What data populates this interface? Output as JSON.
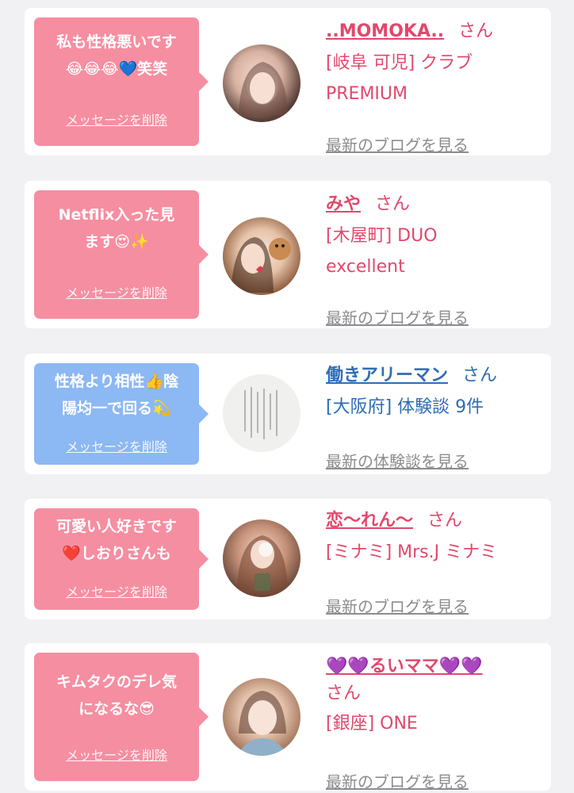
{
  "colors": {
    "pink_bubble": "#f68ea1",
    "blue_bubble": "#8cb8f3",
    "pink_text": "#e2486c",
    "blue_text": "#2d6db4",
    "link_gray": "#8c8c8c"
  },
  "cards": [
    {
      "message": "私も性格悪いです\n😂😂😂💙笑笑",
      "delete_label": "メッセージを削除",
      "name": "..MOMOKA..",
      "honorific": "さん",
      "shop": "[岐阜 可児] クラブ\nPREMIUM",
      "link": "最新のブログを見る",
      "avatar_icon": "profile-photo"
    },
    {
      "message": "Netflix入った見\nます😍✨",
      "delete_label": "メッセージを削除",
      "name": "みや",
      "honorific": "さん",
      "shop": "[木屋町] DUO\nexcellent",
      "link": "最新のブログを見る",
      "avatar_icon": "profile-photo"
    },
    {
      "message": "性格より相性👍陰\n陽均一で回る💫",
      "delete_label": "メッセージを削除",
      "name": "働きアリーマン",
      "honorific": "さん",
      "shop": "[大阪府] 体験談 9件",
      "link": "最新の体験談を見る",
      "avatar_icon": "document-photo"
    },
    {
      "message": "可愛い人好きです\n❤️しおりさんも",
      "delete_label": "メッセージを削除",
      "name": "恋〜れん〜",
      "honorific": "さん",
      "shop": "[ミナミ] Mrs.J ミナミ",
      "link": "最新のブログを見る",
      "avatar_icon": "profile-photo"
    },
    {
      "message": "キムタクのデレ気\nになるな😎",
      "delete_label": "メッセージを削除",
      "name": "💜💜るいママ💜💜",
      "honorific": "さん",
      "shop": "[銀座] ONE",
      "link": "最新のブログを見る",
      "avatar_icon": "profile-photo"
    }
  ]
}
